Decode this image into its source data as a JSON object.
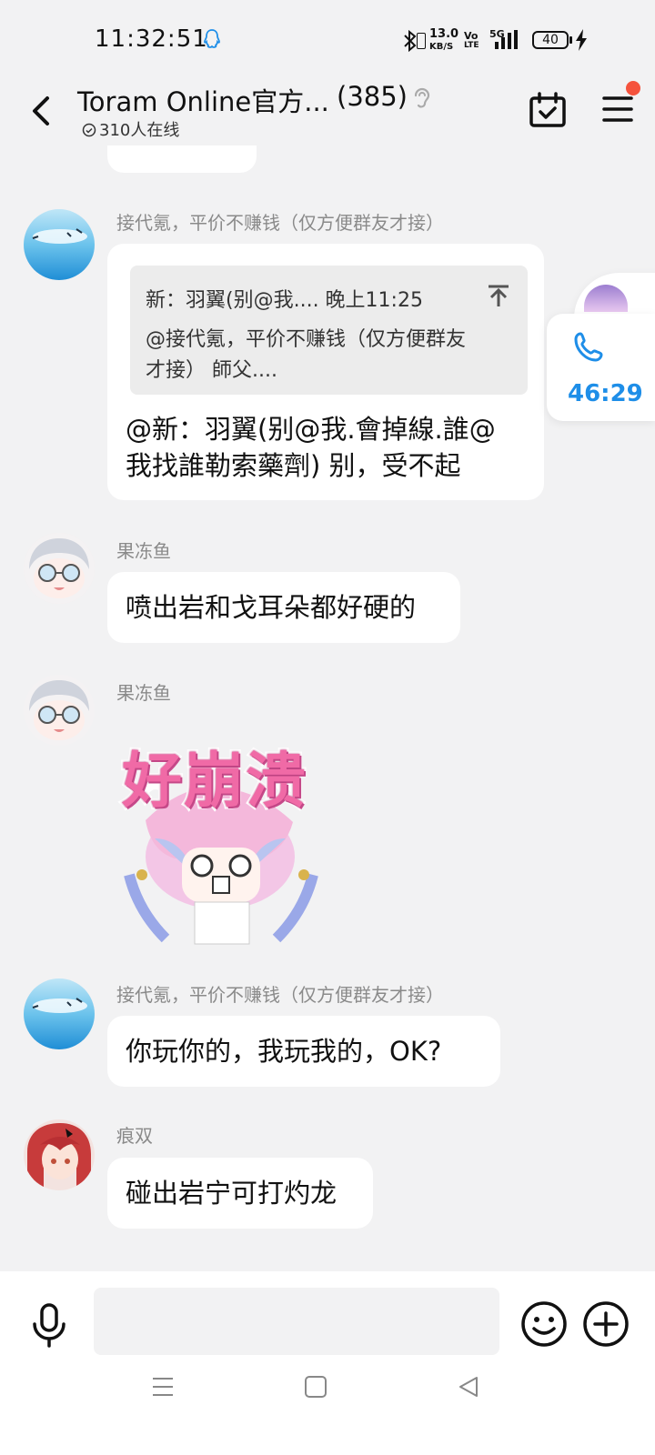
{
  "status_bar": {
    "time": "11:32:51",
    "net_speed_value": "13.0",
    "net_speed_unit": "KB/S",
    "volte_top": "Vo",
    "volte_bottom": "LTE",
    "network": "5G",
    "battery": "40"
  },
  "header": {
    "title": "Toram Online官方...",
    "member_count": "(385)",
    "online_text": "310人在线"
  },
  "messages": [
    {
      "sender": "接代氪，平价不赚钱（仅方便群友才接）",
      "quote_header": "新：羽翼(别@我.... 晚上11:25",
      "quote_line1": "@接代氪，平价不赚钱（仅方便群友",
      "quote_line2": "才接） 師父....",
      "text_line1": "@新：羽翼(别@我.會掉線.誰@",
      "text_line2": "我找誰勒索藥劑) 别，受不起"
    },
    {
      "sender": "果冻鱼",
      "text": "喷出岩和戈耳朵都好硬的"
    },
    {
      "sender": "果冻鱼",
      "sticker_text": "好崩溃"
    },
    {
      "sender": "接代氪，平价不赚钱（仅方便群友才接）",
      "text": "你玩你的，我玩我的，OK?"
    },
    {
      "sender": "痕双",
      "text": "碰出岩宁可打灼龙"
    }
  ],
  "call_float": {
    "time": "46:29"
  },
  "colors": {
    "background": "#f2f2f3",
    "bubble": "#ffffff",
    "accent_blue": "#1e8ee8",
    "badge_red": "#f5533d",
    "sticker_pink": "#f06aa6"
  },
  "icons": {
    "back": "back-arrow-icon",
    "ear": "ear-icon",
    "calendar": "calendar-check-icon",
    "menu": "hamburger-icon",
    "phone": "phone-icon",
    "mic": "microphone-icon",
    "emoji": "emoji-icon",
    "plus": "plus-icon"
  }
}
